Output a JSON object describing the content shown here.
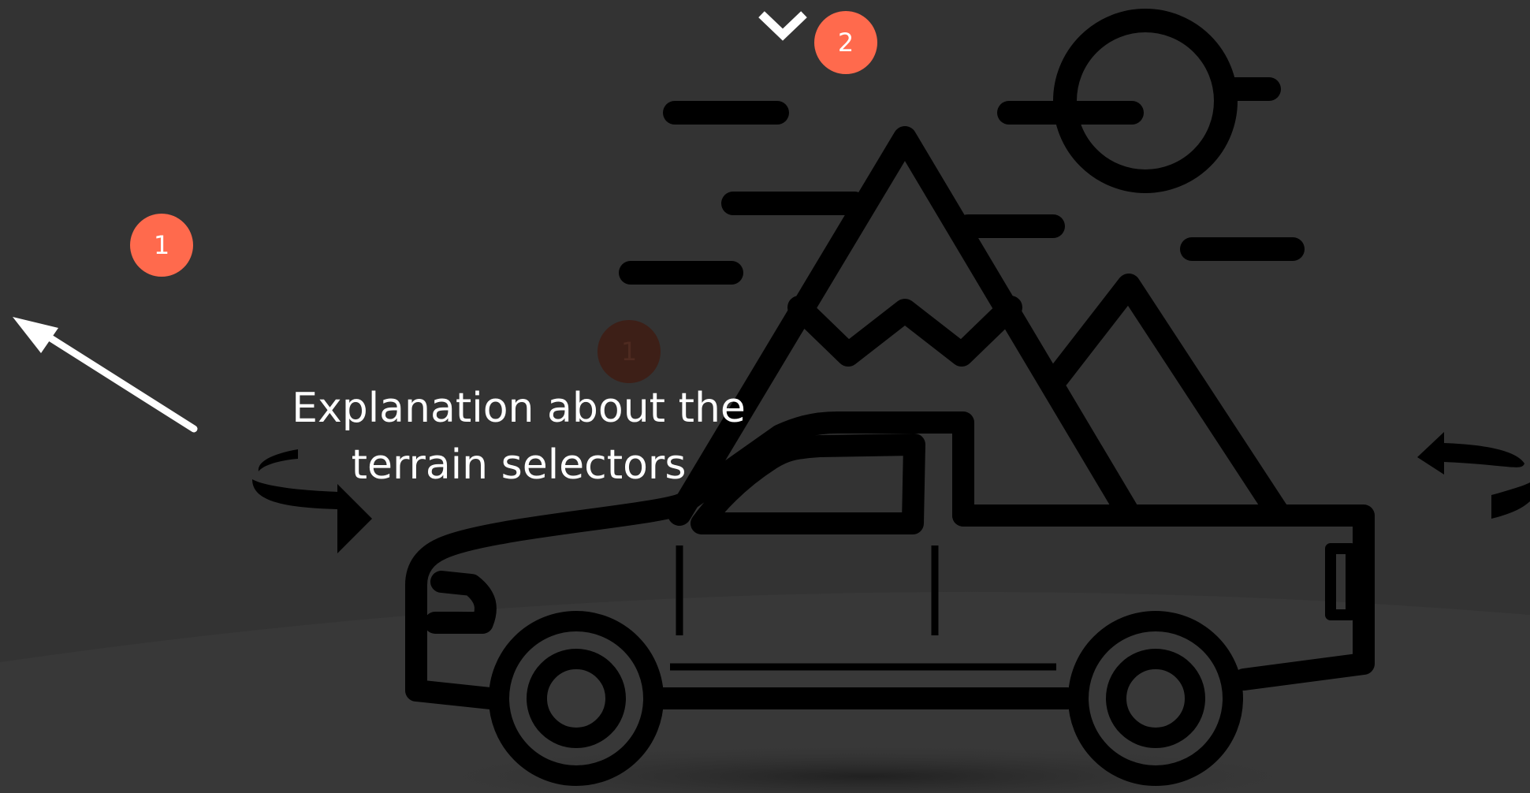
{
  "scene": {
    "background_color": "#333333",
    "accent_color": "#ff6a4d",
    "illustration_icon": "pickup-truck-mountains-sun-icon"
  },
  "hotspots": {
    "left_label": "1",
    "top_label": "2",
    "faded_label": "1"
  },
  "explanation": {
    "text": "Explanation about the\nterrain selectors"
  },
  "controls": {
    "collapse_icon": "chevron-down-icon",
    "rotate_left_icon": "rotate-left-icon",
    "rotate_right_icon": "rotate-right-icon",
    "pointer_icon": "arrow-up-left-icon"
  }
}
